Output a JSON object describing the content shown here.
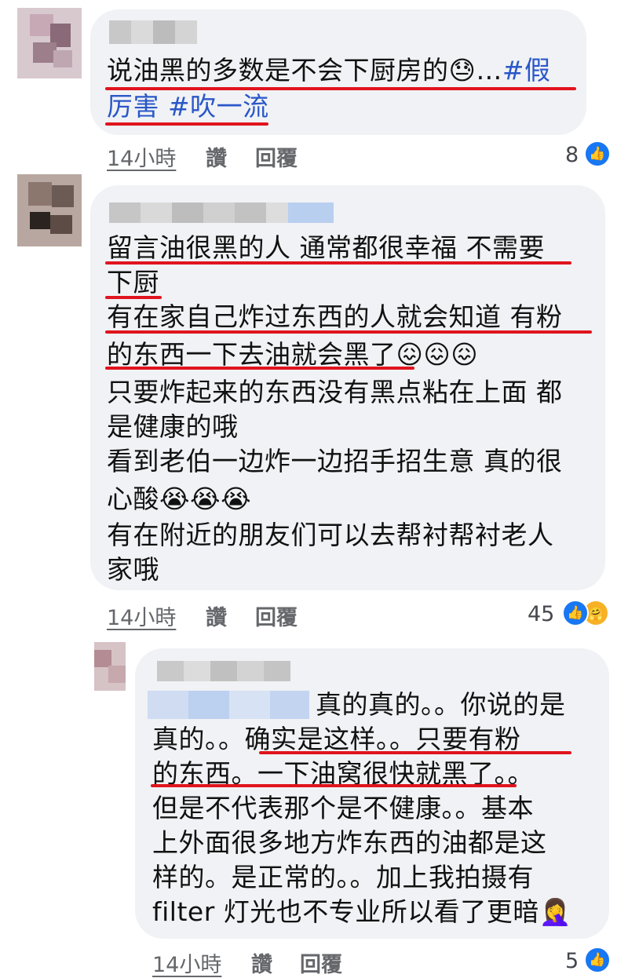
{
  "comments": [
    {
      "lines": [
        "说油黑的多数是不会下厨房的😓…#假",
        "厉害 #吹一流"
      ],
      "time": "14小時",
      "like_label": "讚",
      "reply_label": "回覆",
      "reaction_count": "8",
      "reaction_icons": [
        "like-icon"
      ]
    },
    {
      "lines": [
        "留言油很黑的人 通常都很幸福 不需要",
        "下厨",
        "有在家自己炸过东西的人就会知道 有粉",
        "的东西一下去油就会黑了😖😖😖",
        "只要炸起来的东西没有黑点粘在上面 都",
        "是健康的哦",
        "看到老伯一边炸一边招手招生意 真的很",
        "心酸😭😭😭",
        "有在附近的朋友们可以去帮衬帮衬老人",
        "家哦"
      ],
      "time": "14小時",
      "like_label": "讚",
      "reply_label": "回覆",
      "reaction_count": "45",
      "reaction_icons": [
        "like-icon",
        "care-icon"
      ]
    },
    {
      "lines": [
        "真的真的。。你说的是",
        "真的。。确实是这样。。只要有粉",
        "的东西。一下油窝很快就黑了。。",
        "但是不代表那个是不健康。。基本",
        "上外面很多地方炸东西的油都是这",
        "样的。是正常的。。加上我拍摄有",
        "filter 灯光也不专业所以看了更暗🤦‍♀️"
      ],
      "time": "14小時",
      "like_label": "讚",
      "reply_label": "回覆",
      "reaction_count": "5",
      "reaction_icons": [
        "like-icon"
      ]
    }
  ],
  "colors": {
    "bubble": "#f0f2f5",
    "underline": "#e0141e",
    "hashtag": "#2a57c8",
    "like": "#1877f2",
    "meta": "#65676b"
  }
}
